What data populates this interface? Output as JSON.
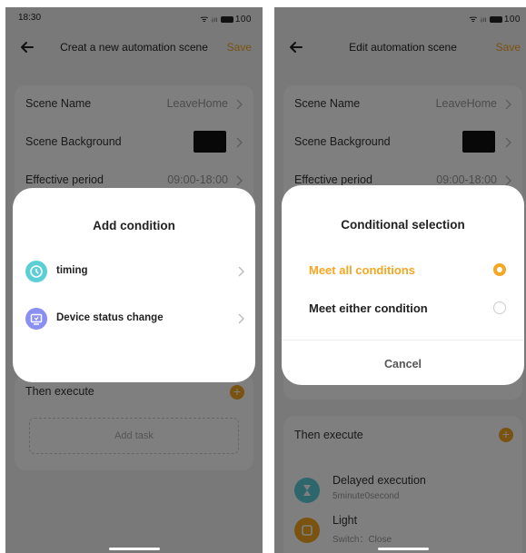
{
  "colors": {
    "accent": "#f5a623",
    "timing_icon": "#5ccfd6",
    "device_icon": "#8c8ff2"
  },
  "left": {
    "status": {
      "time": "18:30",
      "signal": "ᯤ ᵢₗₗ",
      "battery": "100"
    },
    "nav": {
      "title": "Creat a new automation scene",
      "save": "Save"
    },
    "settings": [
      {
        "label": "Scene Name",
        "value": "LeaveHome"
      },
      {
        "label": "Scene Background",
        "value": ""
      },
      {
        "label": "Effective period",
        "value": "09:00-18:00"
      }
    ],
    "then_execute": "Then execute",
    "add_task": "Add task",
    "dialog": {
      "title": "Add condition",
      "options": [
        {
          "label": "timing",
          "icon": "clock-icon"
        },
        {
          "label": "Device status change",
          "icon": "device-icon"
        }
      ]
    }
  },
  "right": {
    "status": {
      "signal": "ᯤ ᵢₗₗ",
      "battery": "100"
    },
    "nav": {
      "title": "Edit automation scene",
      "save": "Save"
    },
    "settings": [
      {
        "label": "Scene Name",
        "value": "LeaveHome"
      },
      {
        "label": "Scene Background",
        "value": ""
      },
      {
        "label": "Effective period",
        "value": "09:00-18:00"
      }
    ],
    "then_execute": "Then execute",
    "tasks": [
      {
        "name": "Delayed execution",
        "sub": "5minute0second",
        "icon": "hourglass-icon"
      },
      {
        "name": "Light",
        "sub": "Switch：Close",
        "icon": "light-icon"
      }
    ],
    "dialog": {
      "title": "Conditional selection",
      "options": [
        {
          "label": "Meet all conditions",
          "selected": true
        },
        {
          "label": "Meet either condition",
          "selected": false
        }
      ],
      "cancel": "Cancel"
    }
  }
}
